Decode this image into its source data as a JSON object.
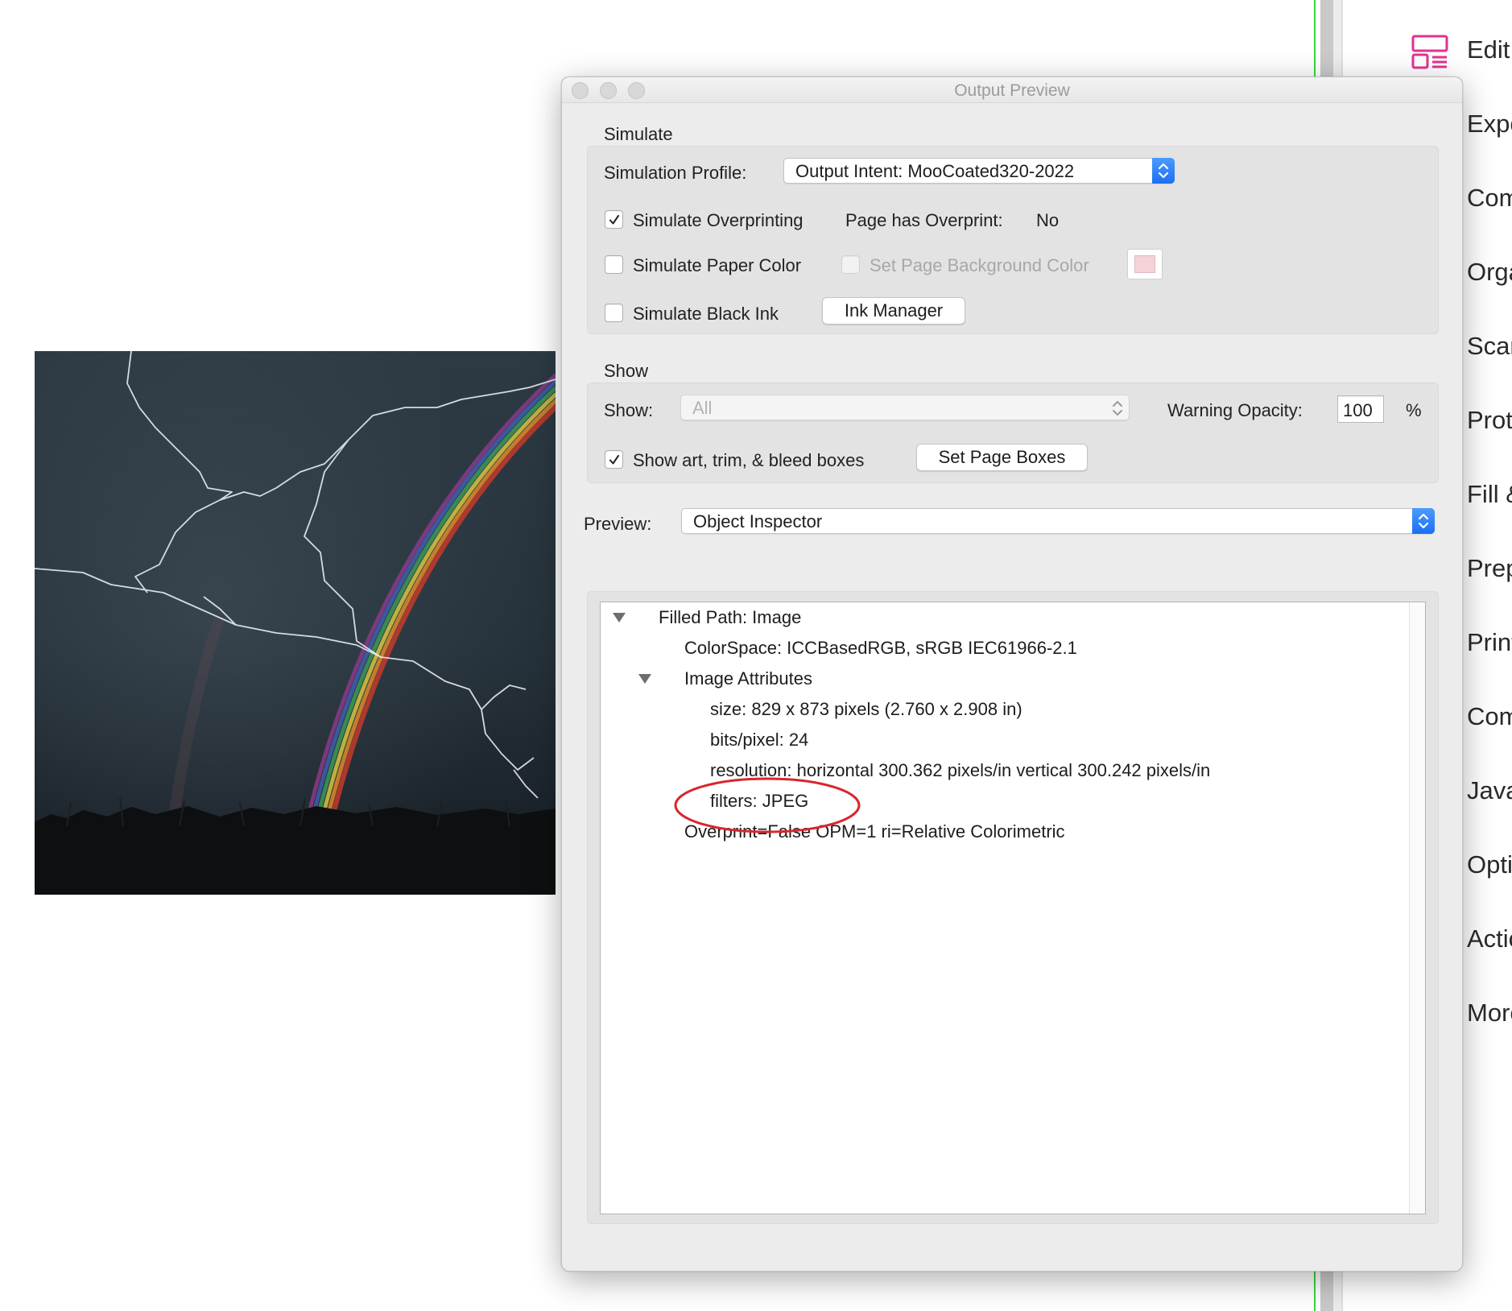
{
  "window": {
    "title": "Output Preview"
  },
  "simulate": {
    "section_title": "Simulate",
    "profile_label": "Simulation Profile:",
    "profile_value": "Output Intent: MooCoated320-2022",
    "overprinting_label": "Simulate Overprinting",
    "overprinting_checked": true,
    "page_has_overprint_label": "Page has Overprint:",
    "page_has_overprint_value": "No",
    "paper_color_label": "Simulate Paper Color",
    "paper_color_checked": false,
    "page_bg_color_label": "Set Page Background Color",
    "page_bg_color_enabled": false,
    "page_bg_color": "#f4d3d8",
    "black_ink_label": "Simulate Black Ink",
    "black_ink_checked": false,
    "ink_manager_button": "Ink Manager"
  },
  "show": {
    "section_title": "Show",
    "show_label": "Show:",
    "show_value": "All",
    "warning_opacity_label": "Warning Opacity:",
    "warning_opacity_value": "100",
    "percent_label": "%",
    "boxes_label": "Show art, trim, & bleed boxes",
    "boxes_checked": true,
    "set_page_boxes_button": "Set Page Boxes"
  },
  "preview": {
    "label": "Preview:",
    "value": "Object Inspector"
  },
  "inspector": {
    "rows": [
      {
        "text": "Filled Path: Image",
        "expanded": true
      },
      {
        "text": "ColorSpace: ICCBasedRGB, sRGB IEC61966-2.1"
      },
      {
        "text": "Image Attributes",
        "expanded": true
      },
      {
        "text": "size: 829 x 873 pixels (2.760 x 2.908 in)"
      },
      {
        "text": "bits/pixel: 24"
      },
      {
        "text": "resolution: horizontal 300.362 pixels/in vertical 300.242 pixels/in"
      },
      {
        "text": "filters: JPEG",
        "highlighted": true
      },
      {
        "text": "Overprint=False OPM=1 ri=Relative Colorimetric"
      }
    ]
  },
  "tools_pane": {
    "items": [
      {
        "label": "Edit",
        "icon": "edit-pdf-icon"
      },
      {
        "label": "Expo"
      },
      {
        "label": "Com"
      },
      {
        "label": "Orga"
      },
      {
        "label": "Scar"
      },
      {
        "label": "Prote"
      },
      {
        "label": "Fill &"
      },
      {
        "label": "Prep"
      },
      {
        "label": "Print"
      },
      {
        "label": "Com"
      },
      {
        "label": "Java"
      },
      {
        "label": "Opti"
      },
      {
        "label": "Actic"
      },
      {
        "label": "More"
      }
    ]
  },
  "colors": {
    "accent_blue": "#1b6ff2",
    "annotation_red": "#d8262d",
    "tool_icon_magenta": "#e0338f",
    "guide_green": "#39d63f"
  }
}
